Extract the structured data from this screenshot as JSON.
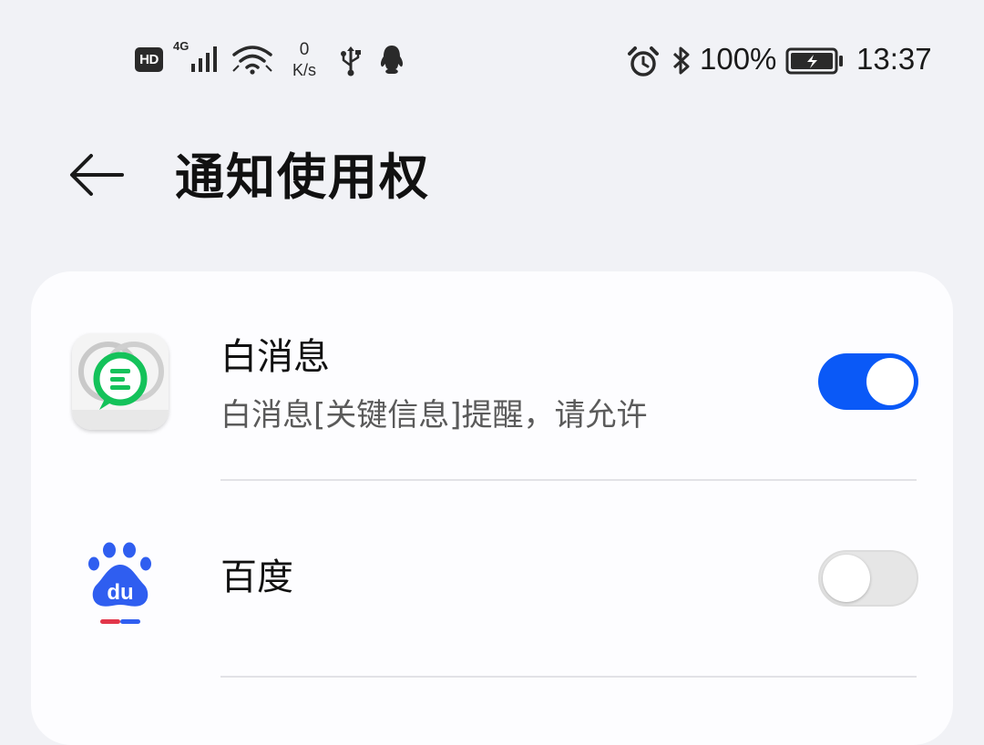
{
  "status_bar": {
    "hd": "HD",
    "network_type": "4G",
    "speed_value": "0",
    "speed_unit": "K/s",
    "battery_percent": "100%",
    "time": "13:37",
    "icons": [
      "signal-icon",
      "wifi-icon",
      "usb-icon",
      "qq-icon",
      "alarm-icon",
      "bluetooth-icon",
      "battery-charging-icon"
    ]
  },
  "header": {
    "title": "通知使用权",
    "back_icon": "arrow-left-icon"
  },
  "apps": [
    {
      "name": "白消息",
      "description": "白消息[关键信息]提醒，请允许",
      "enabled": true,
      "icon": "white-message-app-icon"
    },
    {
      "name": "百度",
      "description": "",
      "enabled": false,
      "icon": "baidu-app-icon",
      "icon_text": "du"
    }
  ],
  "colors": {
    "background": "#f1f2f6",
    "card": "#fdfdff",
    "accent": "#0a59f7",
    "toggle_off": "#e6e6e6",
    "baidu_blue": "#2f5ef0",
    "baidu_red": "#e2364a",
    "white_msg_green": "#14c25a"
  }
}
